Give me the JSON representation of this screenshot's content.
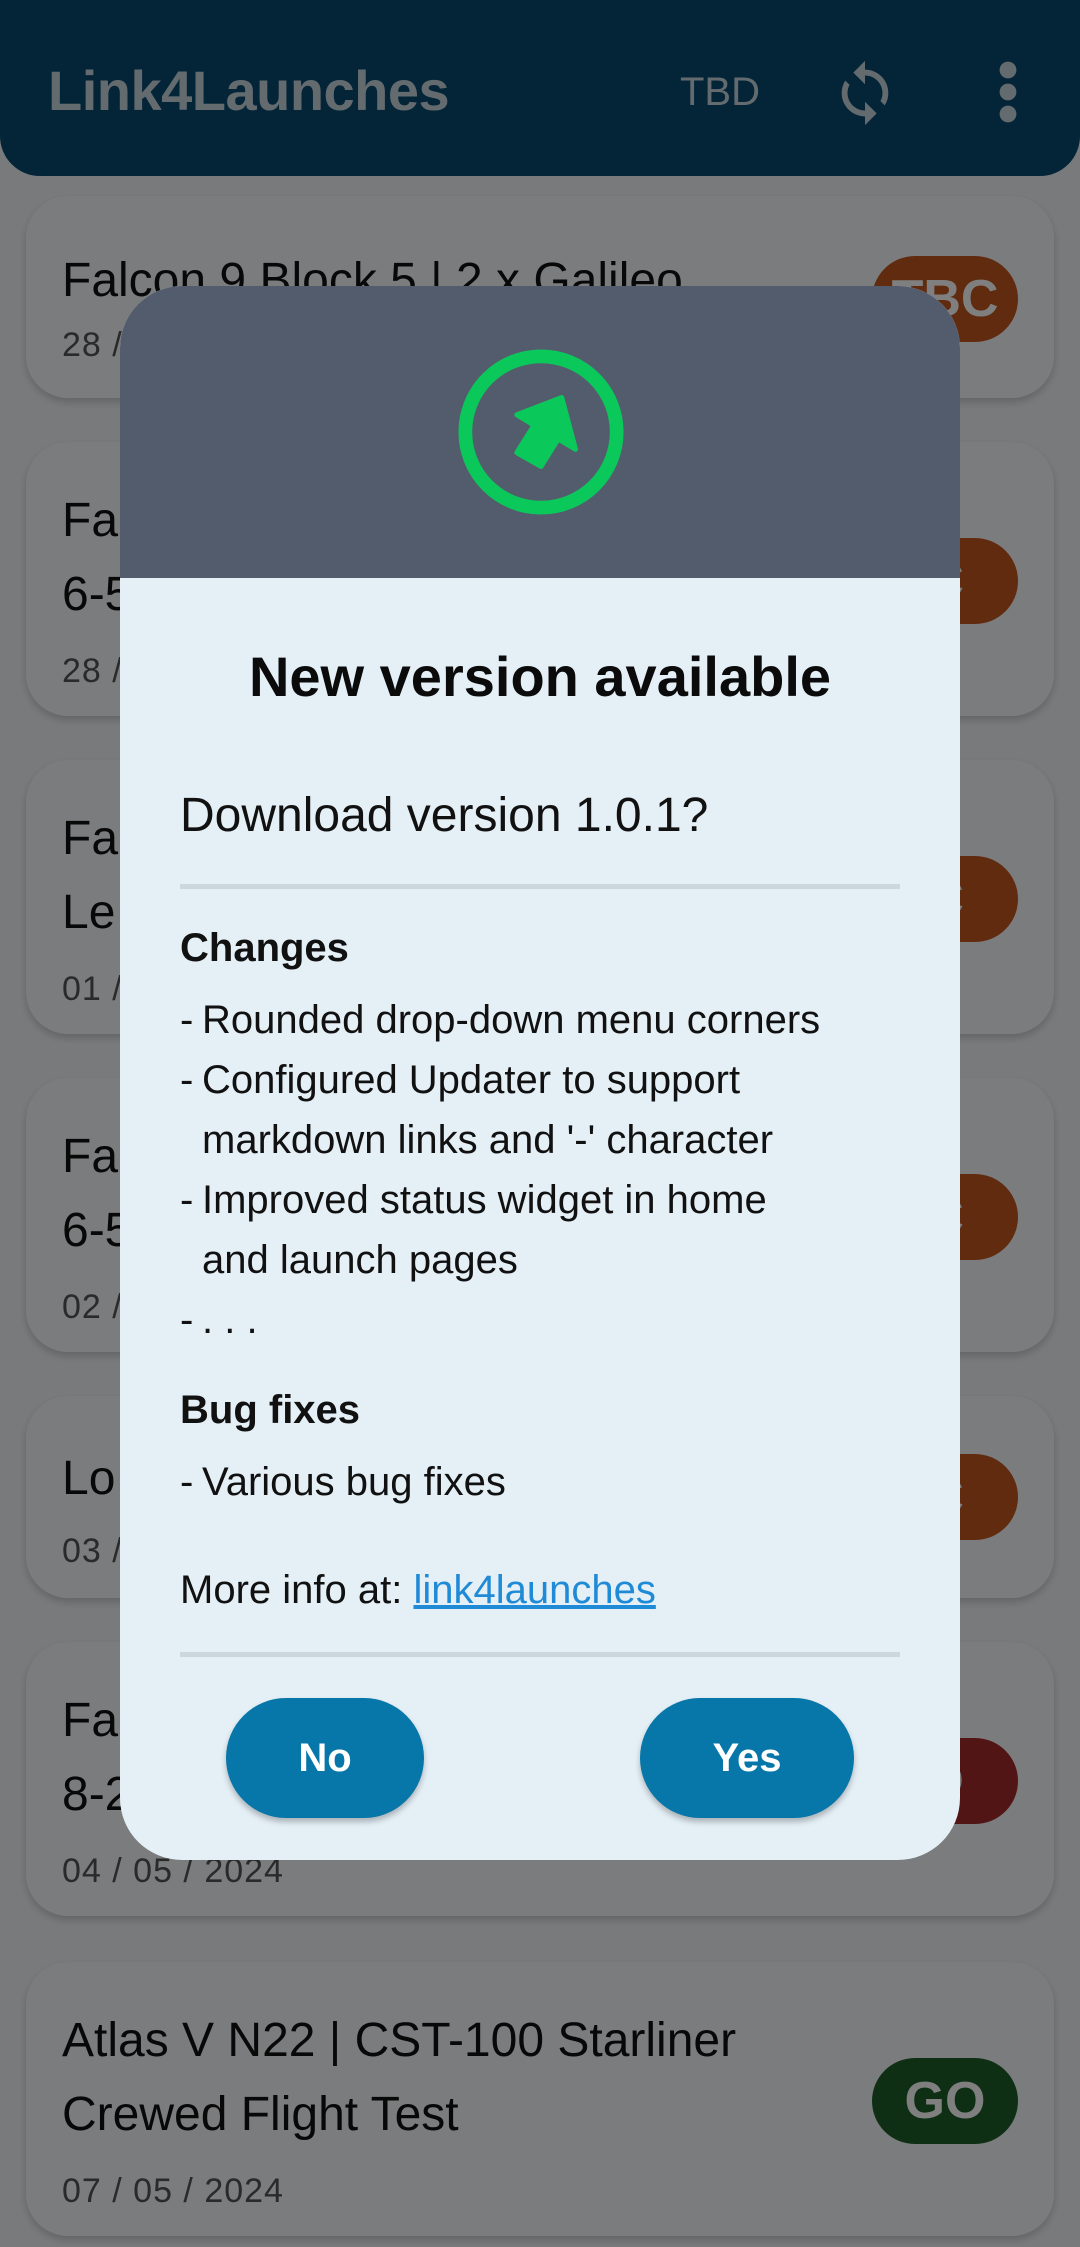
{
  "app_bar": {
    "title": "Link4Launches",
    "status_filter": "TBD",
    "refresh_icon": "refresh-icon",
    "more_icon": "more-vertical-icon"
  },
  "launches": [
    {
      "title": "Falcon 9 Block 5 | 2 x Galileo",
      "date": "28 / ",
      "status": "TBC",
      "status_color": "#c0561e"
    },
    {
      "title": "Fa\n6-5",
      "date": "28 /",
      "status": "C",
      "status_color": "#c0561e"
    },
    {
      "title": "Fa\nLe",
      "date": "01 /",
      "status": "C",
      "status_color": "#c0561e"
    },
    {
      "title": "Fa\n6-5",
      "date": "02 /",
      "status": "C",
      "status_color": "#c0561e"
    },
    {
      "title": "Lo",
      "date": "03 /",
      "status": "C",
      "status_color": "#c0561e"
    },
    {
      "title": "Fa\n8-2",
      "date": "04 / 05 / 2024",
      "status": "D",
      "status_color": "#a32a2a"
    },
    {
      "title": "Atlas V N22 | CST-100 Starliner\nCrewed Flight Test",
      "date": "07 / 05 / 2024",
      "status": "GO",
      "status_color": "#1f5e2b"
    }
  ],
  "dialog": {
    "header_icon": "update-arrow-icon",
    "title": "New version available",
    "question": "Download version 1.0.1?",
    "changes_heading": "Changes",
    "changes": [
      {
        "dash": "-",
        "text": "Rounded drop-down menu corners"
      },
      {
        "dash": "-",
        "text": "Configured Updater to support"
      },
      {
        "dash": "",
        "text": "markdown links and '-' character"
      },
      {
        "dash": "-",
        "text": "Improved status widget in home"
      },
      {
        "dash": "",
        "text": "and launch pages"
      },
      {
        "dash": "-",
        "text": ". . ."
      }
    ],
    "bugfix_heading": "Bug fixes",
    "bugfixes": [
      {
        "dash": "-",
        "text": "Various bug fixes"
      }
    ],
    "more_info_label": "More info at:",
    "more_info_link": "link4launches",
    "no_label": "No",
    "yes_label": "Yes",
    "accent_color": "#0776a9",
    "icon_color": "#0bc85b"
  }
}
